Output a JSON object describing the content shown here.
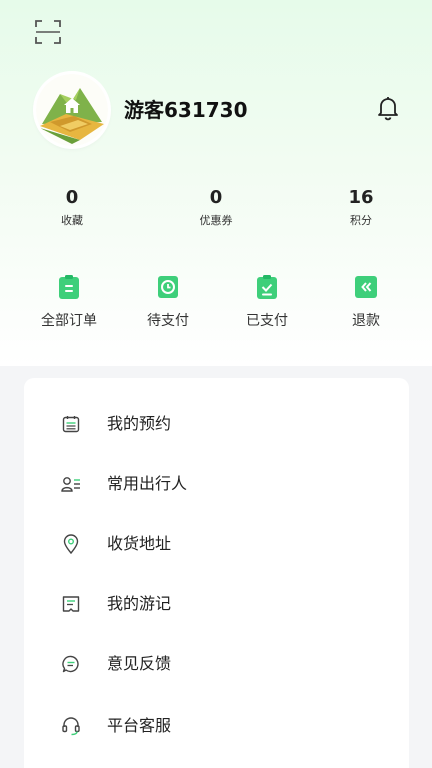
{
  "header": {
    "scan_icon": "scan-icon",
    "bell_icon": "bell-icon"
  },
  "profile": {
    "username": "游客631730",
    "avatar_icon": "farm-house-avatar"
  },
  "stats": [
    {
      "value": "0",
      "label": "收藏"
    },
    {
      "value": "0",
      "label": "优惠券"
    },
    {
      "value": "16",
      "label": "积分"
    }
  ],
  "orders": [
    {
      "label": "全部订单",
      "icon": "all-orders-icon"
    },
    {
      "label": "待支付",
      "icon": "pending-payment-icon"
    },
    {
      "label": "已支付",
      "icon": "paid-icon"
    },
    {
      "label": "退款",
      "icon": "refund-icon"
    }
  ],
  "menu": [
    {
      "label": "我的预约",
      "icon": "calendar-icon"
    },
    {
      "label": "常用出行人",
      "icon": "traveler-card-icon"
    },
    {
      "label": "收货地址",
      "icon": "location-pin-icon"
    },
    {
      "label": "我的游记",
      "icon": "journal-icon"
    },
    {
      "label": "意见反馈",
      "icon": "feedback-bubble-icon"
    },
    {
      "label": "平台客服",
      "icon": "headset-icon"
    }
  ],
  "colors": {
    "accent": "#3ecf7a",
    "accent_dark": "#23b865",
    "icon_gray": "#444444"
  }
}
